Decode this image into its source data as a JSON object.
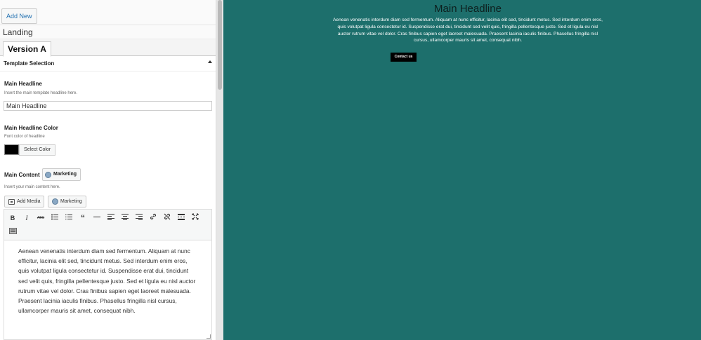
{
  "sidebar": {
    "add_new_label": "Add New",
    "landing_label": "Landing",
    "tab_label": "Version A",
    "section_title": "Template Selection",
    "main_headline": {
      "label": "Main Headline",
      "description": "Insert the main template headline here.",
      "value": "Main Headline"
    },
    "headline_color": {
      "label": "Main Headline Color",
      "description": "Font color of headline",
      "swatch_color": "#000000",
      "button_label": "Select Color"
    },
    "main_content": {
      "label": "Main Content",
      "marketing_button": "Marketing",
      "description": "Insert your main content here.",
      "add_media_button": "Add Media",
      "marketing_button_2": "Marketing"
    },
    "editor": {
      "toolbar_icons": [
        "bold-icon",
        "italic-icon",
        "strikethrough-icon",
        "bullet-list-icon",
        "numbered-list-icon",
        "blockquote-icon",
        "horizontal-line-icon",
        "align-left-icon",
        "align-center-icon",
        "align-right-icon",
        "link-icon",
        "unlink-icon",
        "read-more-icon",
        "fullscreen-icon",
        "toolbar-toggle-icon"
      ],
      "content": "Aenean venenatis interdum diam sed fermentum. Aliquam at nunc efficitur, lacinia elit sed, tincidunt metus. Sed interdum enim eros, quis volutpat ligula consectetur id. Suspendisse erat dui, tincidunt sed velit quis, fringilla pellentesque justo. Sed et ligula eu nisl auctor rutrum vitae vel dolor. Cras finibus sapien eget laoreet malesuada. Praesent lacinia iaculis finibus. Phasellus fringilla nisl cursus, ullamcorper mauris sit amet, consequat nibh."
    }
  },
  "preview": {
    "headline": "Main Headline",
    "body": "Aenean venenatis interdum diam sed fermentum. Aliquam at nunc efficitur, lacinia elit sed, tincidunt metus. Sed interdum enim eros, quis volutpat ligula consectetur id. Suspendisse erat dui, tincidunt sed velit quis, fringilla pellentesque justo. Sed et ligula eu nisl auctor rutrum vitae vel dolor. Cras finibus sapien eget laoreet malesuada. Praesent lacinia iaculis finibus. Phasellus fringilla nisl cursus, ullamcorper mauris sit amet, consequat nibh.",
    "cta_label": "Contact us",
    "background_color": "#1d6f6c"
  }
}
